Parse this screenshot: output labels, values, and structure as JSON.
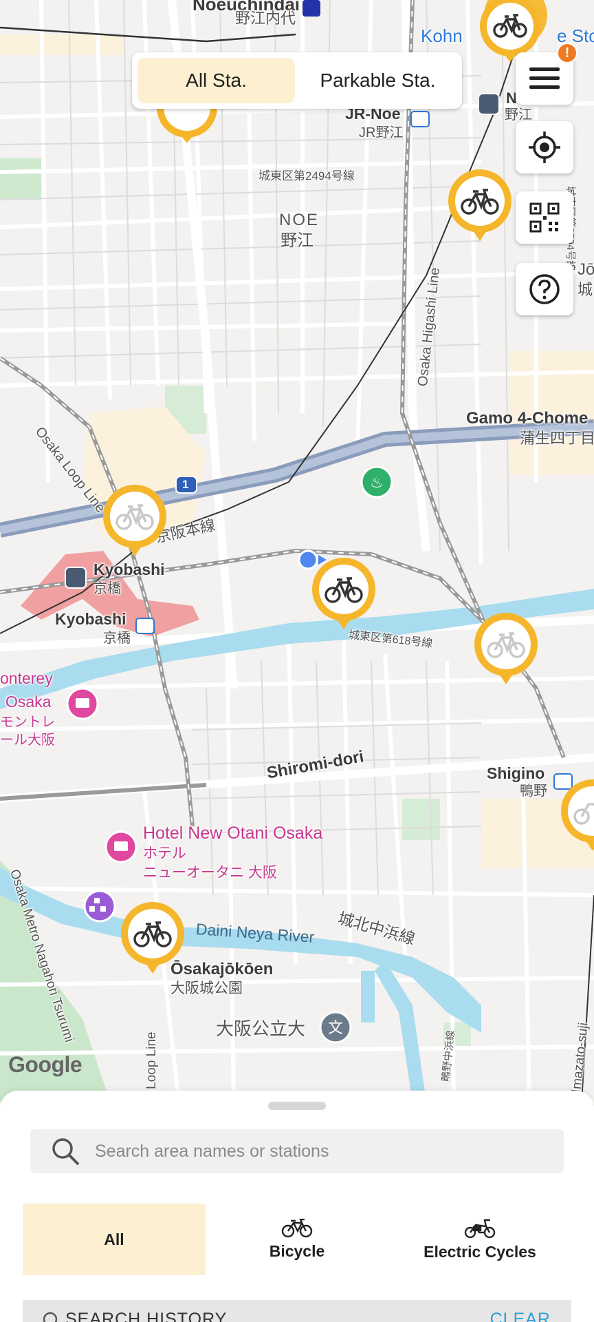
{
  "toggle": {
    "all_label": "All Sta.",
    "parkable_label": "Parkable Sta.",
    "selected": "All Sta."
  },
  "controls": {
    "menu_badge": "!"
  },
  "map": {
    "labels": {
      "noeuchindai": "Noeuchindai",
      "noeuchindai_jp": "野江内代",
      "kohn": "Kohn",
      "store_suffix": "e Sto",
      "jr_noe": "JR-Noe",
      "jr_noe_jp": "JR野江",
      "n_station": "N",
      "noe_small_jp": "野江",
      "road_2494": "城東区第2494号線",
      "road_2594": "城東区第2594号線",
      "noe": "NOE",
      "noe_jp": "野江",
      "osaka_higashi_line": "Osaka Higashi Line",
      "osaka_loop_line": "Osaka Loop Line",
      "gamo": "Gamo 4-Chome",
      "gamo_jp": "蒲生四丁目",
      "keihan_line": "京阪本線",
      "route_1": "1",
      "kyobashi_1": "Kyobashi",
      "kyobashi_1_jp": "京橋",
      "kyobashi_2": "Kyobashi",
      "kyobashi_2_jp": "京橋",
      "road_618": "城東区第618号線",
      "monterey_1": "onterey",
      "monterey_2": "Osaka",
      "monterey_jp_1": "モントレ",
      "monterey_jp_2": "ール大阪",
      "shiromi": "Shiromi-dori",
      "shigino": "Shigino",
      "shigino_jp": "鴨野",
      "hotel": "Hotel New Otani Osaka",
      "hotel_jp_1": "ホテル",
      "hotel_jp_2": "ニューオータニ 大阪",
      "daini_neya": "Daini Neya River",
      "jyohoku": "城北中浜線",
      "osakajokoen": "Ōsakajōkōen",
      "osakajokoen_jp": "大阪城公園",
      "univ": "大阪公立大",
      "loop_line_bottom": "Loop Line",
      "nagahori": "Osaka Metro Nagahori Tsurumi",
      "imazato": "Imazato-suji",
      "shigino_road": "鴫野中浜線",
      "jo": "Jō",
      "jo_jp": "城",
      "google": "Google"
    }
  },
  "search": {
    "placeholder": "Search area names or stations",
    "value": ""
  },
  "types": [
    {
      "label": "All",
      "icon": "none",
      "active": true
    },
    {
      "label": "Bicycle",
      "icon": "bicycle-icon",
      "active": false
    },
    {
      "label": "Electric Cycles",
      "icon": "electric-cycle-icon",
      "active": false
    }
  ],
  "history": {
    "title": "SEARCH HISTORY",
    "clear": "CLEAR"
  },
  "colors": {
    "accent": "#f5b62b",
    "active_bg": "#fcf0d1",
    "water": "#a9dcef",
    "park": "#c8e8c8",
    "railway": "#7a8aa8"
  }
}
